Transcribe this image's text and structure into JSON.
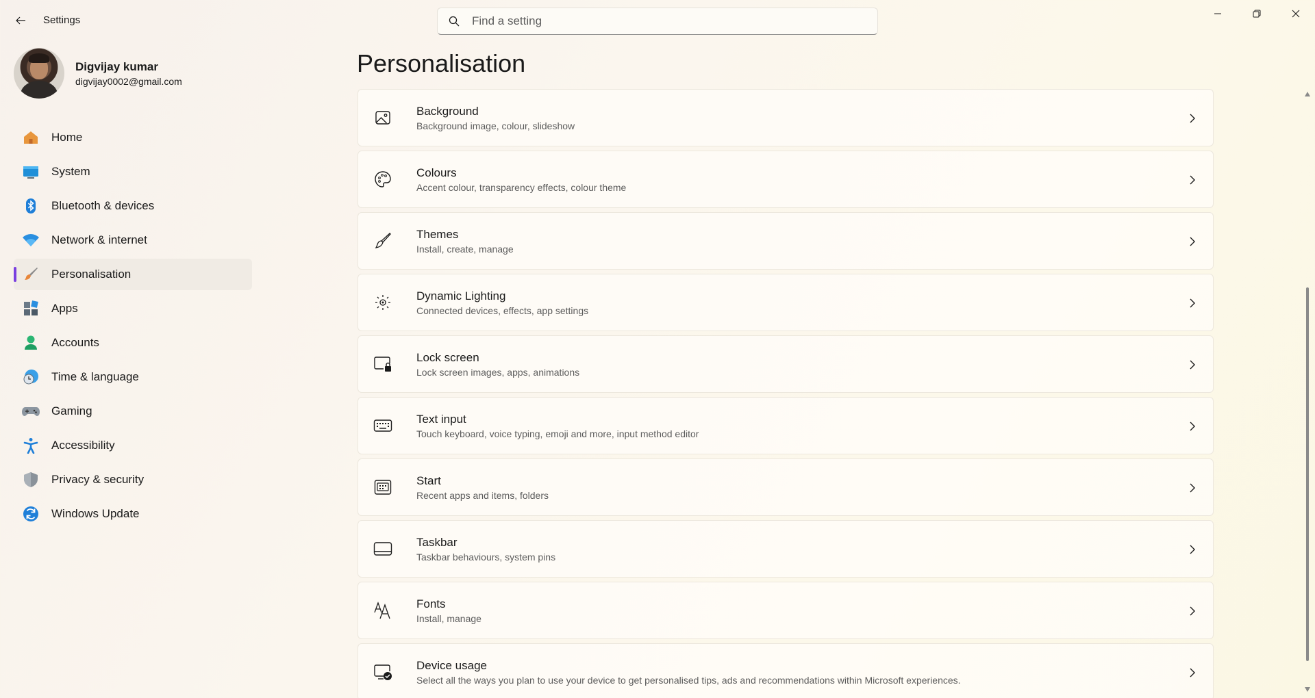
{
  "window": {
    "title": "Settings",
    "controls": [
      "minimize-icon",
      "restore-icon",
      "close-icon"
    ]
  },
  "search": {
    "placeholder": "Find a setting",
    "value": ""
  },
  "profile": {
    "name": "Digvijay kumar",
    "email": "digvijay0002@gmail.com"
  },
  "sidebar": {
    "items": [
      {
        "label": "Home",
        "icon": "home-icon"
      },
      {
        "label": "System",
        "icon": "monitor-icon"
      },
      {
        "label": "Bluetooth & devices",
        "icon": "bluetooth-icon"
      },
      {
        "label": "Network & internet",
        "icon": "wifi-icon"
      },
      {
        "label": "Personalisation",
        "icon": "brush-icon",
        "active": true
      },
      {
        "label": "Apps",
        "icon": "apps-icon"
      },
      {
        "label": "Accounts",
        "icon": "person-icon"
      },
      {
        "label": "Time & language",
        "icon": "clock-globe-icon"
      },
      {
        "label": "Gaming",
        "icon": "gamepad-icon"
      },
      {
        "label": "Accessibility",
        "icon": "accessibility-icon"
      },
      {
        "label": "Privacy & security",
        "icon": "shield-icon"
      },
      {
        "label": "Windows Update",
        "icon": "update-icon"
      }
    ],
    "accent": "#7a3fe0"
  },
  "main": {
    "title": "Personalisation",
    "items": [
      {
        "title": "Background",
        "subtitle": "Background image, colour, slideshow",
        "icon": "image-icon"
      },
      {
        "title": "Colours",
        "subtitle": "Accent colour, transparency effects, colour theme",
        "icon": "palette-icon"
      },
      {
        "title": "Themes",
        "subtitle": "Install, create, manage",
        "icon": "brush-icon"
      },
      {
        "title": "Dynamic Lighting",
        "subtitle": "Connected devices, effects, app settings",
        "icon": "lighting-icon"
      },
      {
        "title": "Lock screen",
        "subtitle": "Lock screen images, apps, animations",
        "icon": "lock-screen-icon"
      },
      {
        "title": "Text input",
        "subtitle": "Touch keyboard, voice typing, emoji and more, input method editor",
        "icon": "keyboard-icon"
      },
      {
        "title": "Start",
        "subtitle": "Recent apps and items, folders",
        "icon": "start-icon"
      },
      {
        "title": "Taskbar",
        "subtitle": "Taskbar behaviours, system pins",
        "icon": "taskbar-icon"
      },
      {
        "title": "Fonts",
        "subtitle": "Install, manage",
        "icon": "fonts-icon"
      },
      {
        "title": "Device usage",
        "subtitle": "Select all the ways you plan to use your device to get personalised tips, ads and recommendations within Microsoft experiences.",
        "icon": "device-usage-icon"
      }
    ]
  }
}
